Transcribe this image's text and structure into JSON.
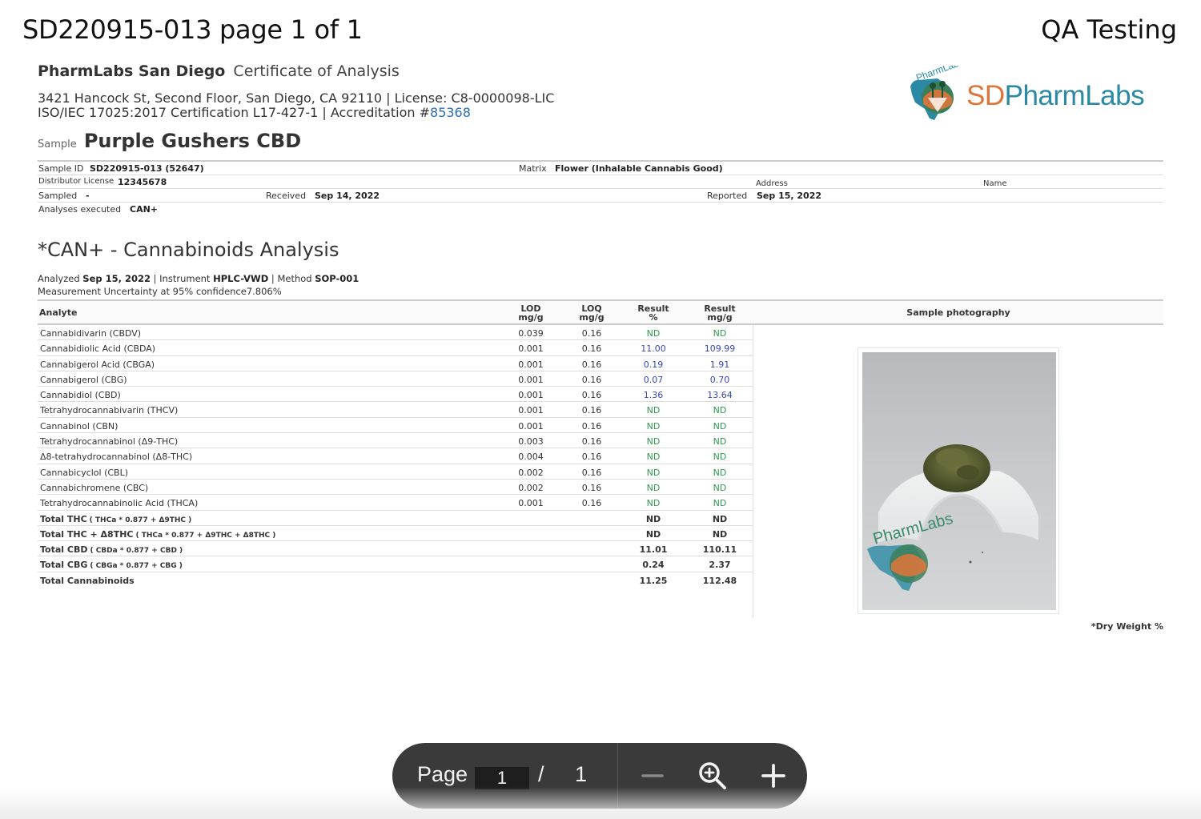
{
  "viewer": {
    "doc_id": "SD220915-013 page 1 of 1",
    "tag": "QA Testing",
    "toolbar": {
      "page_label": "Page",
      "page_value": "1",
      "separator": "/",
      "page_total": "1",
      "icons": [
        "zoom-out-icon",
        "zoom-magnifier-icon",
        "zoom-in-icon"
      ]
    }
  },
  "lab": {
    "name": "PharmLabs San Diego",
    "doc_title": "Certificate of Analysis",
    "address_line": "3421 Hancock St, Second Floor, San Diego, CA 92110 |  License: C8-0000098-LIC",
    "cert_line": "ISO/IEC 17025:2017 Certification L17-427-1 |  Accreditation #",
    "accreditation_number": "85368",
    "logo": {
      "mark_text": "PharmLabs",
      "sd": "SD",
      "pharmlabs": "PharmLabs"
    }
  },
  "sample": {
    "label": "Sample",
    "name": "Purple Gushers CBD",
    "sample_id_label": "Sample ID",
    "sample_id": "SD220915-013 (52647)",
    "matrix_label": "Matrix",
    "matrix": "Flower (Inhalable Cannabis Good)",
    "distributor_label": "Distributor License",
    "distributor": "12345678",
    "address_label": "Address",
    "name_label": "Name",
    "sampled_label": "Sampled",
    "sampled": "-",
    "received_label": "Received",
    "received": "Sep 14, 2022",
    "reported_label": "Reported",
    "reported": "Sep 15, 2022",
    "analyses_label": "Analyses executed",
    "analyses": "CAN+"
  },
  "analysis": {
    "title": "*CAN+ - Cannabinoids Analysis",
    "analyzed_label": "Analyzed",
    "analyzed": "Sep 15, 2022",
    "instrument_label": "|  Instrument",
    "instrument": "HPLC-VWD",
    "method_label": "|  Method",
    "method": "SOP-001",
    "uncertainty_label": "Measurement Uncertainty at 95% confidence",
    "uncertainty": "7.806%",
    "headers": {
      "analyte": "Analyte",
      "lod": "LOD",
      "lod_unit": "mg/g",
      "loq": "LOQ",
      "loq_unit": "mg/g",
      "result_pct": "Result",
      "result_pct_unit": "%",
      "result_mg": "Result",
      "result_mg_unit": "mg/g",
      "photo": "Sample photography"
    },
    "rows": [
      {
        "name": "Cannabidivarin (CBDV)",
        "lod": "0.039",
        "loq": "0.16",
        "pct": "ND",
        "mg": "ND"
      },
      {
        "name": "Cannabidiolic Acid (CBDA)",
        "lod": "0.001",
        "loq": "0.16",
        "pct": "11.00",
        "mg": "109.99"
      },
      {
        "name": "Cannabigerol Acid (CBGA)",
        "lod": "0.001",
        "loq": "0.16",
        "pct": "0.19",
        "mg": "1.91"
      },
      {
        "name": "Cannabigerol (CBG)",
        "lod": "0.001",
        "loq": "0.16",
        "pct": "0.07",
        "mg": "0.70"
      },
      {
        "name": "Cannabidiol (CBD)",
        "lod": "0.001",
        "loq": "0.16",
        "pct": "1.36",
        "mg": "13.64"
      },
      {
        "name": "Tetrahydrocannabivarin (THCV)",
        "lod": "0.001",
        "loq": "0.16",
        "pct": "ND",
        "mg": "ND"
      },
      {
        "name": "Cannabinol (CBN)",
        "lod": "0.001",
        "loq": "0.16",
        "pct": "ND",
        "mg": "ND"
      },
      {
        "name": "Tetrahydrocannabinol (Δ9-THC)",
        "lod": "0.003",
        "loq": "0.16",
        "pct": "ND",
        "mg": "ND"
      },
      {
        "name": "Δ8-tetrahydrocannabinol (Δ8-THC)",
        "lod": "0.004",
        "loq": "0.16",
        "pct": "ND",
        "mg": "ND"
      },
      {
        "name": "Cannabicyclol (CBL)",
        "lod": "0.002",
        "loq": "0.16",
        "pct": "ND",
        "mg": "ND"
      },
      {
        "name": "Cannabichromene (CBC)",
        "lod": "0.002",
        "loq": "0.16",
        "pct": "ND",
        "mg": "ND"
      },
      {
        "name": "Tetrahydrocannabinolic Acid (THCA)",
        "lod": "0.001",
        "loq": "0.16",
        "pct": "ND",
        "mg": "ND"
      }
    ],
    "totals": [
      {
        "name": "Total THC",
        "formula": "( THCa * 0.877 + Δ9THC )",
        "pct": "ND",
        "mg": "ND"
      },
      {
        "name": "Total THC + Δ8THC",
        "formula": "( THCa * 0.877 + Δ9THC + Δ8THC )",
        "pct": "ND",
        "mg": "ND"
      },
      {
        "name": "Total CBD",
        "formula": "( CBDa * 0.877 + CBD )",
        "pct": "11.01",
        "mg": "110.11"
      },
      {
        "name": "Total CBG",
        "formula": "( CBGa * 0.877 + CBG )",
        "pct": "0.24",
        "mg": "2.37"
      },
      {
        "name": "Total Cannabinoids",
        "formula": "",
        "pct": "11.25",
        "mg": "112.48"
      }
    ],
    "photo_watermark": "PharmLabs",
    "footnote": "*Dry Weight %"
  },
  "colors": {
    "nd": "#2d9b50",
    "positive": "#3646b8",
    "link": "#2a6fb3",
    "logo_orange": "#e0753a",
    "logo_teal": "#2a8aa5",
    "toolbar": "#3a3a3a"
  }
}
